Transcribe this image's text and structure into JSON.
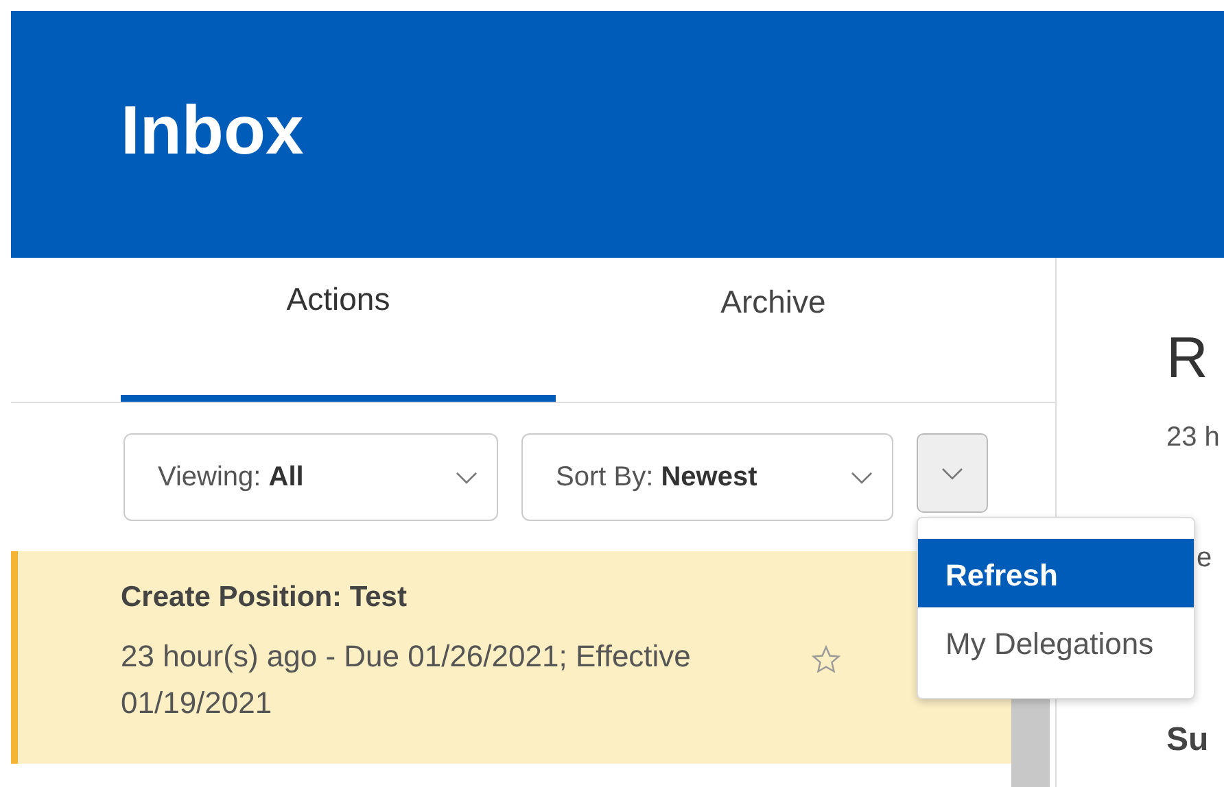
{
  "header": {
    "title": "Inbox"
  },
  "tabs": [
    {
      "label": "Actions",
      "selected": true
    },
    {
      "label": "Archive",
      "selected": false
    }
  ],
  "filters": [
    {
      "text": "Viewing: **All**"
    },
    {
      "text": "Sort By: **Newest**"
    }
  ],
  "menu": {
    "expanded": true,
    "items": [
      {
        "label": "Refresh",
        "selected": true
      },
      {
        "label": "My Delegations",
        "selected": false
      }
    ]
  },
  "inbox_items": [
    {
      "title": "Create Position: Test",
      "subtitle": "23 hour(s) ago - Due 01/26/2021; Effective 01/19/2021",
      "selected": true,
      "starred": false
    }
  ],
  "detail": {
    "title": "R",
    "meta": "23 h",
    "line": "e",
    "section": "Su"
  }
}
